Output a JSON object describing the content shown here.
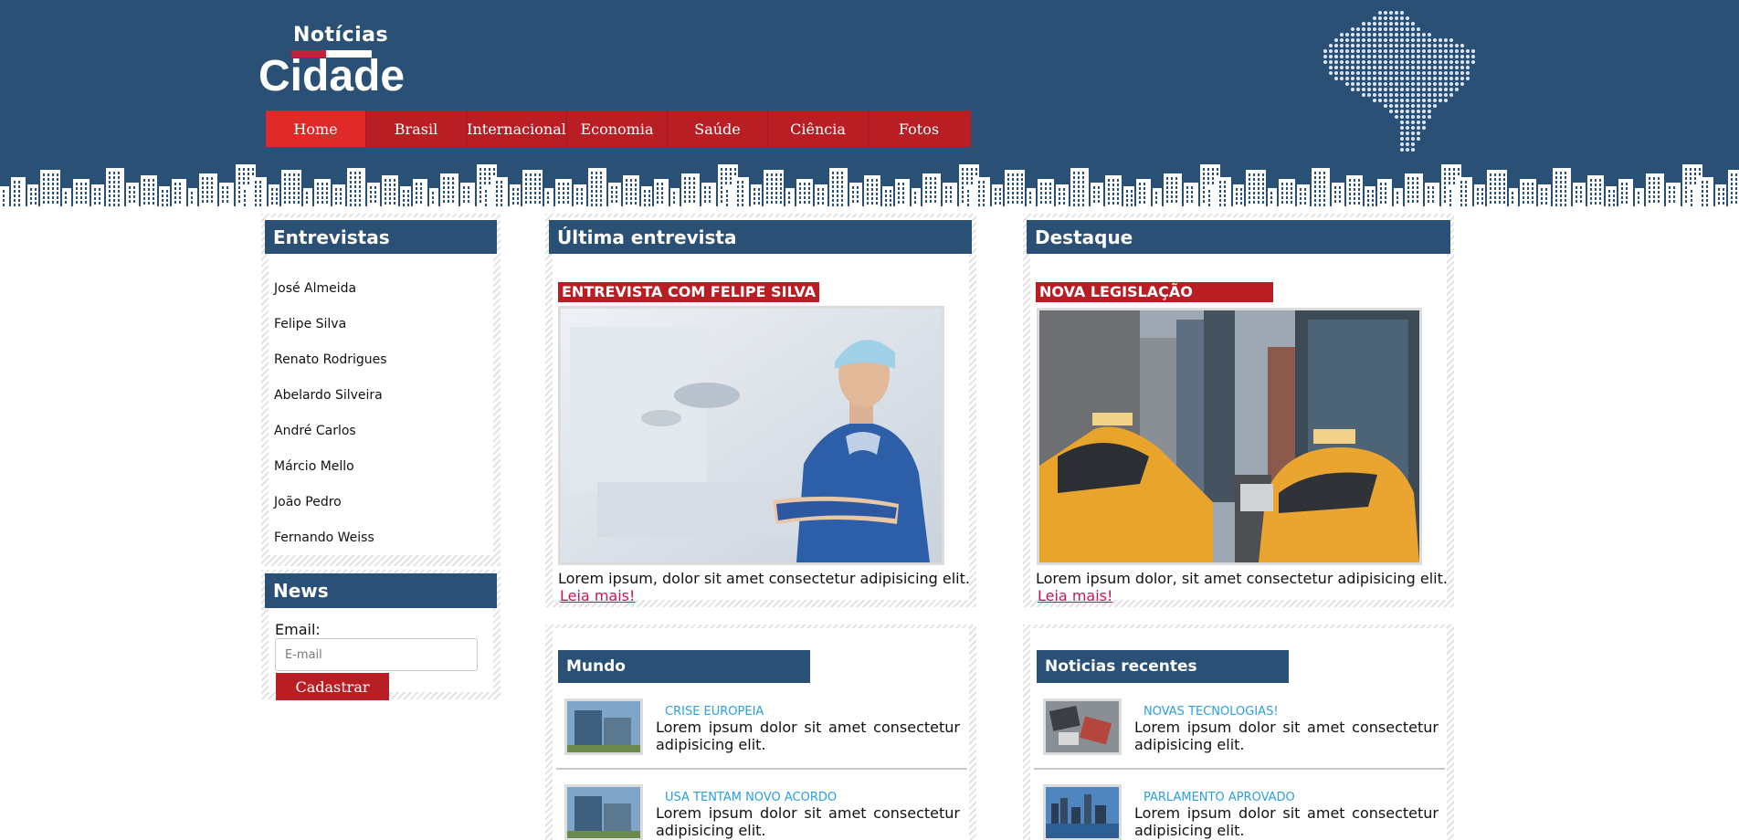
{
  "logo": {
    "top": "Notícias",
    "main": "Cidade"
  },
  "nav": [
    "Home",
    "Brasil",
    "Internacional",
    "Economia",
    "Saúde",
    "Ciência",
    "Fotos"
  ],
  "entrevistas": {
    "title": "Entrevistas",
    "items": [
      "José Almeida",
      "Felipe Silva",
      "Renato Rodrigues",
      "Abelardo Silveira",
      "André Carlos",
      "Márcio Mello",
      "João Pedro",
      "Fernando Weiss"
    ]
  },
  "news": {
    "title": "News",
    "email_label": "Email:",
    "email_placeholder": "E-mail",
    "button": "Cadastrar"
  },
  "ultima": {
    "title": "Última entrevista",
    "tag": "ENTREVISTA COM FELIPE SILVA",
    "text": "Lorem ipsum, dolor sit amet consectetur adipisicing elit.",
    "link": "Leia mais!"
  },
  "destaque": {
    "title": "Destaque",
    "tag": "NOVA LEGISLAÇÃO",
    "text": "Lorem ipsum dolor, sit amet consectetur adipisicing elit.",
    "link": "Leia mais!"
  },
  "mundo": {
    "title": "Mundo",
    "items": [
      {
        "category": "Crise europeia",
        "text_1": "Lorem ipsum dolor sit amet consectetur",
        "text_2": "adipisicing elit."
      },
      {
        "category": "USA tentam novo acordo",
        "text_1": "Lorem ipsum dolor sit amet consectetur",
        "text_2": "adipisicing elit."
      }
    ]
  },
  "recentes": {
    "title": "Noticias recentes",
    "items": [
      {
        "category": "Novas tecnologias!",
        "text_1": "Lorem ipsum dolor sit amet consectetur",
        "text_2": "adipisicing elit."
      },
      {
        "category": "Parlamento aprovado",
        "text_1": "Lorem ipsum dolor sit amet consectetur",
        "text_2": "adipisicing elit."
      }
    ]
  },
  "colors": {
    "header_blue": "#2b5075",
    "nav_red": "#b81e24",
    "nav_active": "#e02a2a",
    "link_pink": "#c2185b",
    "category_blue": "#2a9fe0"
  }
}
